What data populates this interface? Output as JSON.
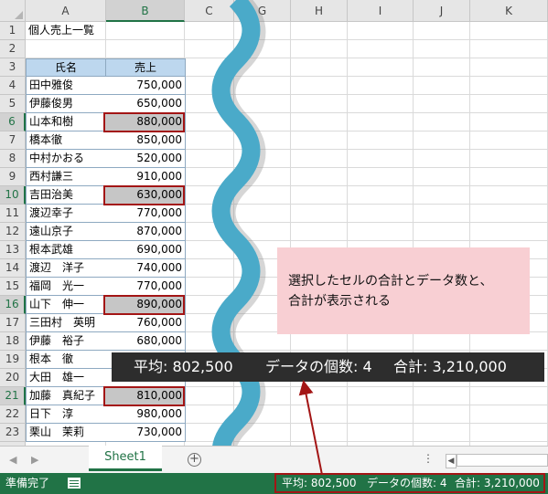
{
  "columns": [
    "A",
    "B",
    "C",
    "G",
    "H",
    "I",
    "J",
    "K"
  ],
  "rows": [
    "1",
    "2",
    "3",
    "4",
    "5",
    "6",
    "7",
    "8",
    "9",
    "10",
    "11",
    "12",
    "13",
    "14",
    "15",
    "16",
    "17",
    "18",
    "19",
    "20",
    "21",
    "22",
    "23",
    "24"
  ],
  "selected_rows": [
    "6",
    "10",
    "16",
    "21"
  ],
  "cells": {
    "a1": "個人売上一覧",
    "header_name": "氏名",
    "header_sales": "売上"
  },
  "table": [
    {
      "name": "田中雅俊",
      "sales": "750,000",
      "selected": false
    },
    {
      "name": "伊藤俊男",
      "sales": "650,000",
      "selected": false
    },
    {
      "name": "山本和樹",
      "sales": "880,000",
      "selected": true
    },
    {
      "name": "橋本徹",
      "sales": "850,000",
      "selected": false
    },
    {
      "name": "中村かおる",
      "sales": "520,000",
      "selected": false
    },
    {
      "name": "西村謙三",
      "sales": "910,000",
      "selected": false
    },
    {
      "name": "吉田治美",
      "sales": "630,000",
      "selected": true
    },
    {
      "name": "渡辺幸子",
      "sales": "770,000",
      "selected": false
    },
    {
      "name": "遠山京子",
      "sales": "870,000",
      "selected": false
    },
    {
      "name": "根本武雄",
      "sales": "690,000",
      "selected": false
    },
    {
      "name": "渡辺　洋子",
      "sales": "740,000",
      "selected": false
    },
    {
      "name": "福岡　光一",
      "sales": "770,000",
      "selected": false
    },
    {
      "name": "山下　伸一",
      "sales": "890,000",
      "selected": true
    },
    {
      "name": "三田村　英明",
      "sales": "760,000",
      "selected": false
    },
    {
      "name": "伊藤　裕子",
      "sales": "680,000",
      "selected": false
    },
    {
      "name": "根本　徹",
      "sales": "",
      "selected": false
    },
    {
      "name": "大田　雄一",
      "sales": "",
      "selected": false
    },
    {
      "name": "加藤　真紀子",
      "sales": "810,000",
      "selected": true
    },
    {
      "name": "日下　淳",
      "sales": "980,000",
      "selected": false
    },
    {
      "name": "栗山　茉莉",
      "sales": "730,000",
      "selected": false
    }
  ],
  "callout": {
    "line1": "選択したセルの合計とデータ数と、",
    "line2": "合計が表示される"
  },
  "zoom_stats": {
    "average": "平均: 802,500",
    "count": "データの個数: 4",
    "sum": "合計: 3,210,000"
  },
  "sheet_tab": "Sheet1",
  "status": {
    "ready": "準備完了",
    "average": "平均: 802,500",
    "count": "データの個数: 4",
    "sum": "合計: 3,210,000"
  },
  "colors": {
    "excel_green": "#217346",
    "header_fill": "#bdd7ee",
    "selection_fill": "#c6c6c6",
    "highlight_red": "#a31515",
    "callout_pink": "#f8cfd3",
    "wave_blue": "#4aaac9"
  },
  "icons": {
    "add_sheet": "plus-circle-icon",
    "macro": "macro-record-icon",
    "more": "vertical-dots-icon"
  }
}
